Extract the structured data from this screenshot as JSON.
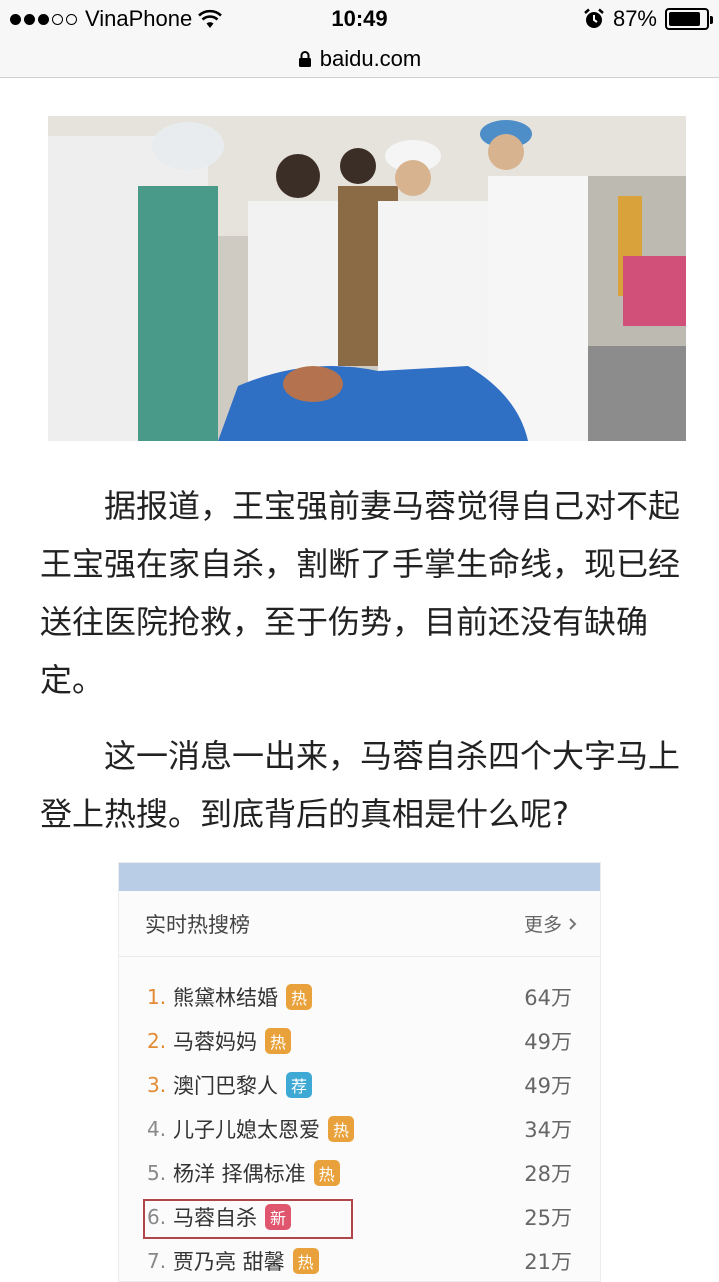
{
  "status_bar": {
    "carrier": "VinaPhone",
    "signal_bars_filled": 3,
    "signal_bars_total": 5,
    "time": "10:49",
    "battery_percent": "87%",
    "battery_level": 0.87
  },
  "url_bar": {
    "domain": "baidu.com"
  },
  "article": {
    "paragraph1": "据报道，王宝强前妻马蓉觉得自己对不起王宝强在家自杀，割断了手掌生命线，现已经送往医院抢救，至于伤势，目前还没有缺确定。",
    "paragraph2": "这一消息一出来，马蓉自杀四个大字马上登上热搜。到底背后的真相是什么呢?"
  },
  "hot_search": {
    "title": "实时热搜榜",
    "more_label": "更多",
    "items": [
      {
        "rank": "1.",
        "name": "熊黛林结婚",
        "tag": "热",
        "tag_color": "#e9a23b",
        "count": "64万"
      },
      {
        "rank": "2.",
        "name": "马蓉妈妈",
        "tag": "热",
        "tag_color": "#e9a23b",
        "count": "49万"
      },
      {
        "rank": "3.",
        "name": "澳门巴黎人",
        "tag": "荐",
        "tag_color": "#3fa9d6",
        "count": "49万"
      },
      {
        "rank": "4.",
        "name": "儿子儿媳太恩爱",
        "tag": "热",
        "tag_color": "#e9a23b",
        "count": "34万"
      },
      {
        "rank": "5.",
        "name": "杨洋 择偶标准",
        "tag": "热",
        "tag_color": "#e9a23b",
        "count": "28万"
      },
      {
        "rank": "6.",
        "name": "马蓉自杀",
        "tag": "新",
        "tag_color": "#e0566e",
        "count": "25万"
      },
      {
        "rank": "7.",
        "name": "贾乃亮 甜馨",
        "tag": "热",
        "tag_color": "#e9a23b",
        "count": "21万"
      }
    ]
  }
}
